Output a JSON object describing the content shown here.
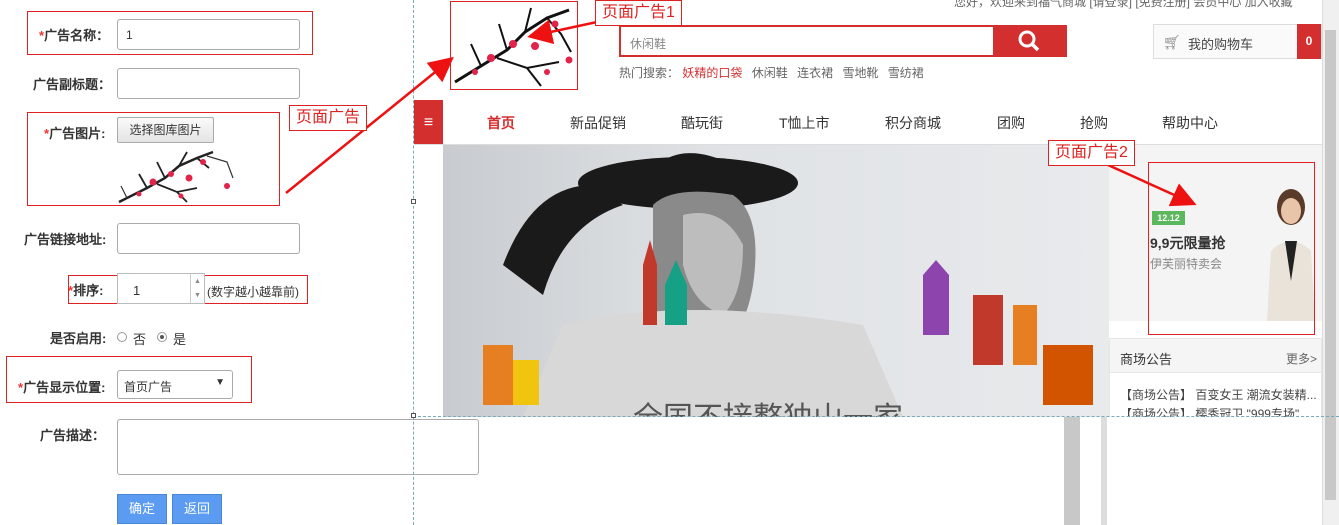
{
  "form": {
    "name_label": "广告名称：",
    "name_value": "1",
    "subtitle_label": "广告副标题：",
    "image_label": "广告图片:",
    "choose_image_button": "选择图库图片",
    "link_label": "广告链接地址:",
    "sort_label": "排序:",
    "sort_value": "1",
    "sort_hint": "(数字越小越靠前)",
    "enabled_label": "是否启用:",
    "enabled_no": "否",
    "enabled_yes": "是",
    "position_label": "广告显示位置:",
    "position_value": "首页广告",
    "desc_label": "广告描述：",
    "confirm_button": "确定",
    "back_button": "返回",
    "required_mark": "*"
  },
  "annotations": {
    "page_ad": "页面广告",
    "page_ad_1": "页面广告1",
    "page_ad_2": "页面广告2"
  },
  "preview": {
    "top_bar_text": "您好，欢迎来到福气商城  [请登录] [免费注册]  会员中心  加入收藏",
    "search_placeholder": "休闲鞋",
    "hot_search_label": "热门搜索：",
    "hot_terms": [
      "妖精的口袋",
      "休闲鞋",
      "连衣裙",
      "雪地靴",
      "雪纺裙"
    ],
    "cart_label": "我的购物车",
    "cart_count": "0",
    "nav": [
      "首页",
      "新品促销",
      "酷玩街",
      "T恤上市",
      "积分商城",
      "团购",
      "抢购",
      "帮助中心"
    ],
    "side_ad_badge": "12.12",
    "side_ad_title": "9,9元限量抢",
    "side_ad_sub": "伊芙丽特卖会",
    "notice_title": "商场公告",
    "notice_more": "更多>",
    "notices": [
      "【商场公告】 百变女王 潮流女装精...",
      "【商场公告】 樱秀冠卫 \"999专场\""
    ],
    "banner_text": "全国不接整独山一家"
  },
  "colors": {
    "accent_red": "#d32f2f",
    "button_blue": "#5b9cf2"
  }
}
